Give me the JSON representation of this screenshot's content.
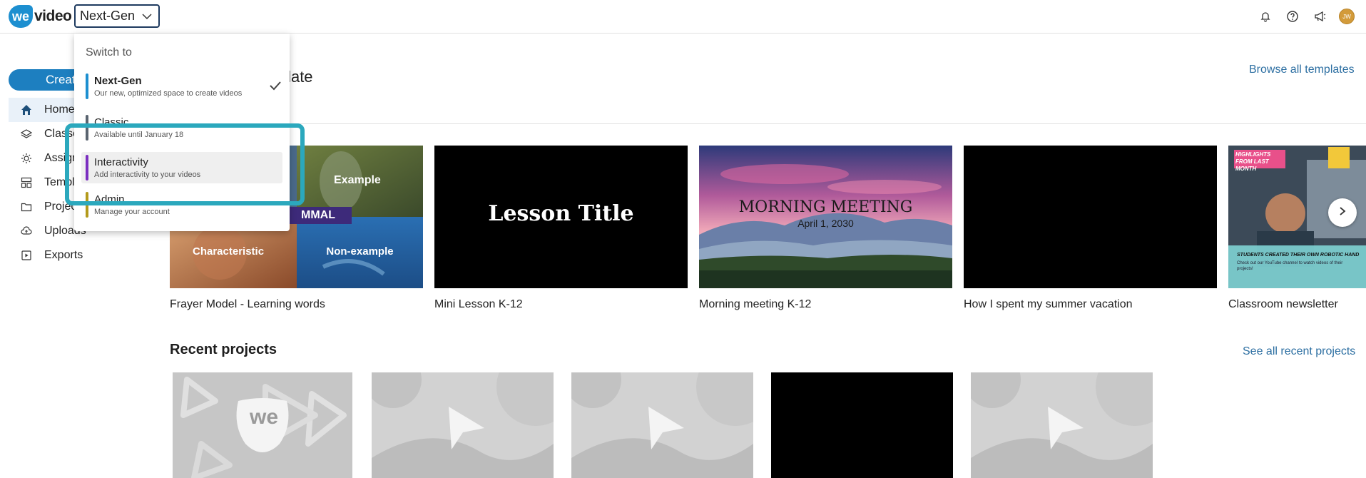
{
  "header": {
    "logo_we": "we",
    "logo_video": "video",
    "workspace": "Next-Gen",
    "avatar_initials": "JW"
  },
  "dropdown": {
    "heading": "Switch to",
    "items": [
      {
        "name": "Next-Gen",
        "desc": "Our new, optimized space to create videos",
        "color": "#1d8fd0",
        "selected": true
      },
      {
        "name": "Classic",
        "desc": "Available until January 18",
        "color": "#5a6470"
      },
      {
        "name": "Interactivity",
        "desc": "Add interactivity to your videos",
        "color": "#7b2fc0"
      },
      {
        "name": "Admin",
        "desc": "Manage your account",
        "color": "#b39a1c"
      }
    ]
  },
  "sidebar": {
    "create_label": "Create",
    "items": [
      {
        "label": "Home",
        "icon": "home-icon"
      },
      {
        "label": "Classes",
        "icon": "layers-icon"
      },
      {
        "label": "Assignments",
        "icon": "sun-icon"
      },
      {
        "label": "Templates",
        "icon": "grid-icon"
      },
      {
        "label": "Projects",
        "icon": "folder-icon"
      },
      {
        "label": "Uploads",
        "icon": "upload-icon"
      },
      {
        "label": "Exports",
        "icon": "export-icon"
      }
    ]
  },
  "templates": {
    "title": "Start with a template",
    "browse_link": "Browse all templates",
    "items": [
      {
        "label": "Frayer Model - Learning words",
        "t1": "Example",
        "t2": "MMAL",
        "t3": "Characteristic",
        "t4": "Non-example"
      },
      {
        "label": "Mini Lesson K-12",
        "thumb_text": "Lesson Title"
      },
      {
        "label": "Morning meeting K-12",
        "thumb_text": "MORNING MEETING",
        "thumb_sub": "April 1, 2030"
      },
      {
        "label": "How I spent my summer vacation"
      },
      {
        "label": "Classroom newsletter",
        "thumb_text": "HIGHLIGHTS FROM LAST MONTH",
        "thumb_sub": "STUDENTS CREATED THEIR OWN ROBOTIC HAND",
        "thumb_small": "Check out our YouTube channel to watch videos of their projects!"
      }
    ]
  },
  "recent": {
    "title": "Recent projects",
    "see_all": "See all recent projects",
    "logo_text": "we"
  },
  "colors": {
    "accent": "#1d7fc0",
    "highlight": "#2ba8bd",
    "link": "#2d6fa2"
  }
}
